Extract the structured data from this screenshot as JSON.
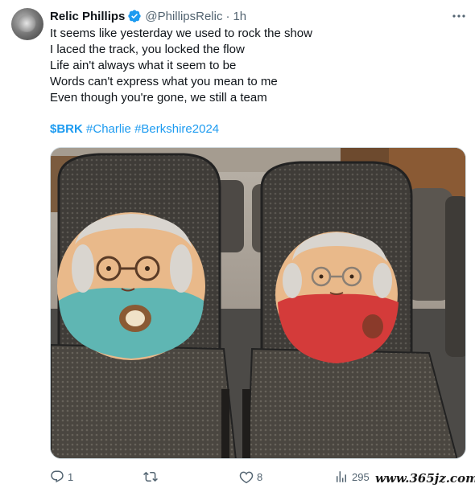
{
  "author": {
    "name": "Relic Phillips",
    "handle": "@PhillipsRelic",
    "separator": "·",
    "time": "1h",
    "verified": true,
    "avatar_icon": "avatar-photo"
  },
  "tweet": {
    "lines": [
      "It seems like yesterday we used to rock the show",
      "I laced the track, you locked the flow",
      "Life ain't always what it seem to be",
      "Words can't express what you mean to me",
      "Even though you're gone, we still a team"
    ],
    "cashtag": "$BRK",
    "hashtags": [
      "#Charlie",
      "#Berkshire2024"
    ]
  },
  "media": {
    "icon": "photo-two-plush-toys-on-chairs"
  },
  "actions": {
    "reply_count": "1",
    "retweet_count": "",
    "like_count": "8",
    "views_count": "295"
  },
  "watermark": "www.365jz.com",
  "colors": {
    "link": "#1d9bf0",
    "secondary_text": "#536471",
    "verified": "#1d9bf0"
  }
}
